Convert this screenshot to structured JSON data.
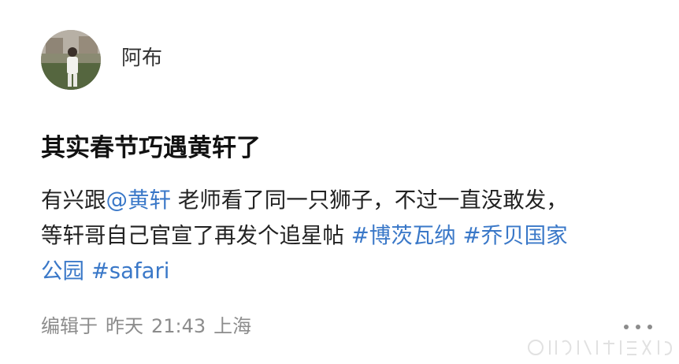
{
  "post": {
    "author": "阿布",
    "title": "其实春节巧遇黄轩了",
    "body": {
      "line1_prefix": "有兴跟",
      "mention": "@黄轩",
      "line1_suffix": " 老师看了同一只狮子，不过一直没敢发，",
      "line2_prefix": "等轩哥自己官宣了再发个追星帖 ",
      "hashtag1": "#博茨瓦纳",
      "hashtag2": "#乔贝国家",
      "line3_prefix": "公园 ",
      "hashtag3": "#safari"
    },
    "meta": {
      "edited": "编辑于",
      "date": "昨天",
      "time": "21:43",
      "location": "上海"
    }
  },
  "colors": {
    "link": "#3a78c8",
    "meta": "#8c8c8c"
  },
  "icons": {
    "avatar": "avatar-photo",
    "more": "more-options-icon",
    "watermark": "watermark-logo"
  }
}
